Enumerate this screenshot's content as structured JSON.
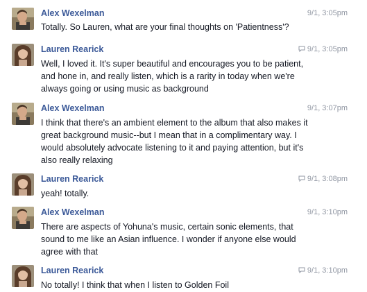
{
  "messages": [
    {
      "author": "Alex Wexelman",
      "time": "9/1, 3:05pm",
      "read_icon": false,
      "avatar": "alex",
      "text": "Totally. So Lauren, what are your final thoughts on 'Patientness'?"
    },
    {
      "author": "Lauren Rearick",
      "time": "9/1, 3:05pm",
      "read_icon": true,
      "avatar": "lauren",
      "text": "Well, I loved it. It's super beautiful and encourages you to be patient, and hone in, and really listen, which is a rarity in today when we're always going or using music as background"
    },
    {
      "author": "Alex Wexelman",
      "time": "9/1, 3:07pm",
      "read_icon": false,
      "avatar": "alex",
      "text": "I think that there's an ambient element to the album that also makes it great background music--but I mean that in a complimentary way. I would absolutely advocate listening to it and paying attention, but it's also really relaxing"
    },
    {
      "author": "Lauren Rearick",
      "time": "9/1, 3:08pm",
      "read_icon": true,
      "avatar": "lauren",
      "text": "yeah! totally."
    },
    {
      "author": "Alex Wexelman",
      "time": "9/1, 3:10pm",
      "read_icon": false,
      "avatar": "alex",
      "text": "There are aspects of Yohuna's music, certain sonic elements, that sound to me like an Asian influence. I wonder if anyone else would agree with that"
    },
    {
      "author": "Lauren Rearick",
      "time": "9/1, 3:10pm",
      "read_icon": true,
      "avatar": "lauren",
      "text": "No totally! I think that when I listen to Golden Foil"
    }
  ],
  "colors": {
    "author_link": "#3b5998",
    "timestamp": "#9197a3",
    "body_text": "#141823"
  },
  "icons": {
    "read_indicator": "chat-bubble-icon"
  }
}
